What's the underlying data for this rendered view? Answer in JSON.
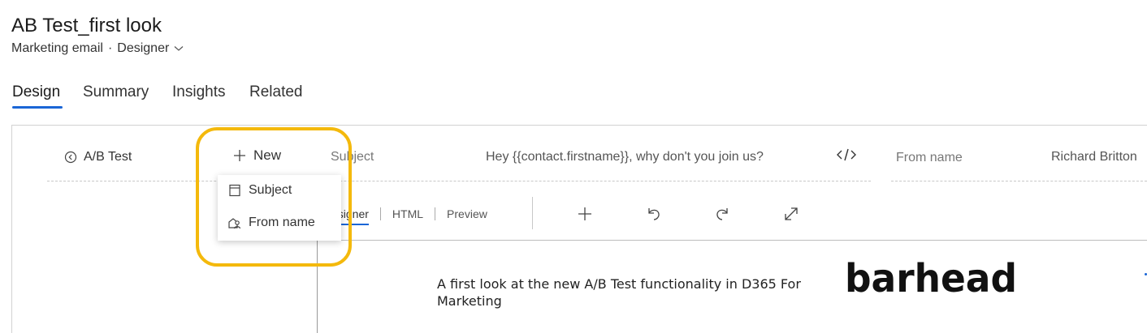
{
  "header": {
    "title": "AB Test_first look",
    "entity": "Marketing email",
    "separator": "·",
    "form": "Designer"
  },
  "tabs": [
    {
      "label": "Design",
      "active": true
    },
    {
      "label": "Summary",
      "active": false
    },
    {
      "label": "Insights",
      "active": false
    },
    {
      "label": "Related",
      "active": false
    }
  ],
  "ab_bar": {
    "back_label": "A/B Test",
    "new_label": "New",
    "subject_label": "Subject",
    "subject_value": "Hey {{contact.firstname}}, why don't you join us?",
    "fromname_label": "From name",
    "fromname_value": "Richard Britton"
  },
  "new_menu": {
    "items": [
      {
        "label": "Subject",
        "icon": "subject-icon"
      },
      {
        "label": "From name",
        "icon": "from-name-icon"
      }
    ]
  },
  "editor": {
    "tabs": [
      "Designer",
      "HTML",
      "Preview"
    ],
    "visible_designer_text": "esigner",
    "tools": [
      "add-icon",
      "undo-icon",
      "redo-icon",
      "expand-icon"
    ]
  },
  "email": {
    "heading": "A first look at the new A/B Test functionality in D365 For Marketing",
    "logo": "barhead"
  },
  "colors": {
    "accent": "#1a66d6",
    "highlight": "#f4b90c"
  }
}
